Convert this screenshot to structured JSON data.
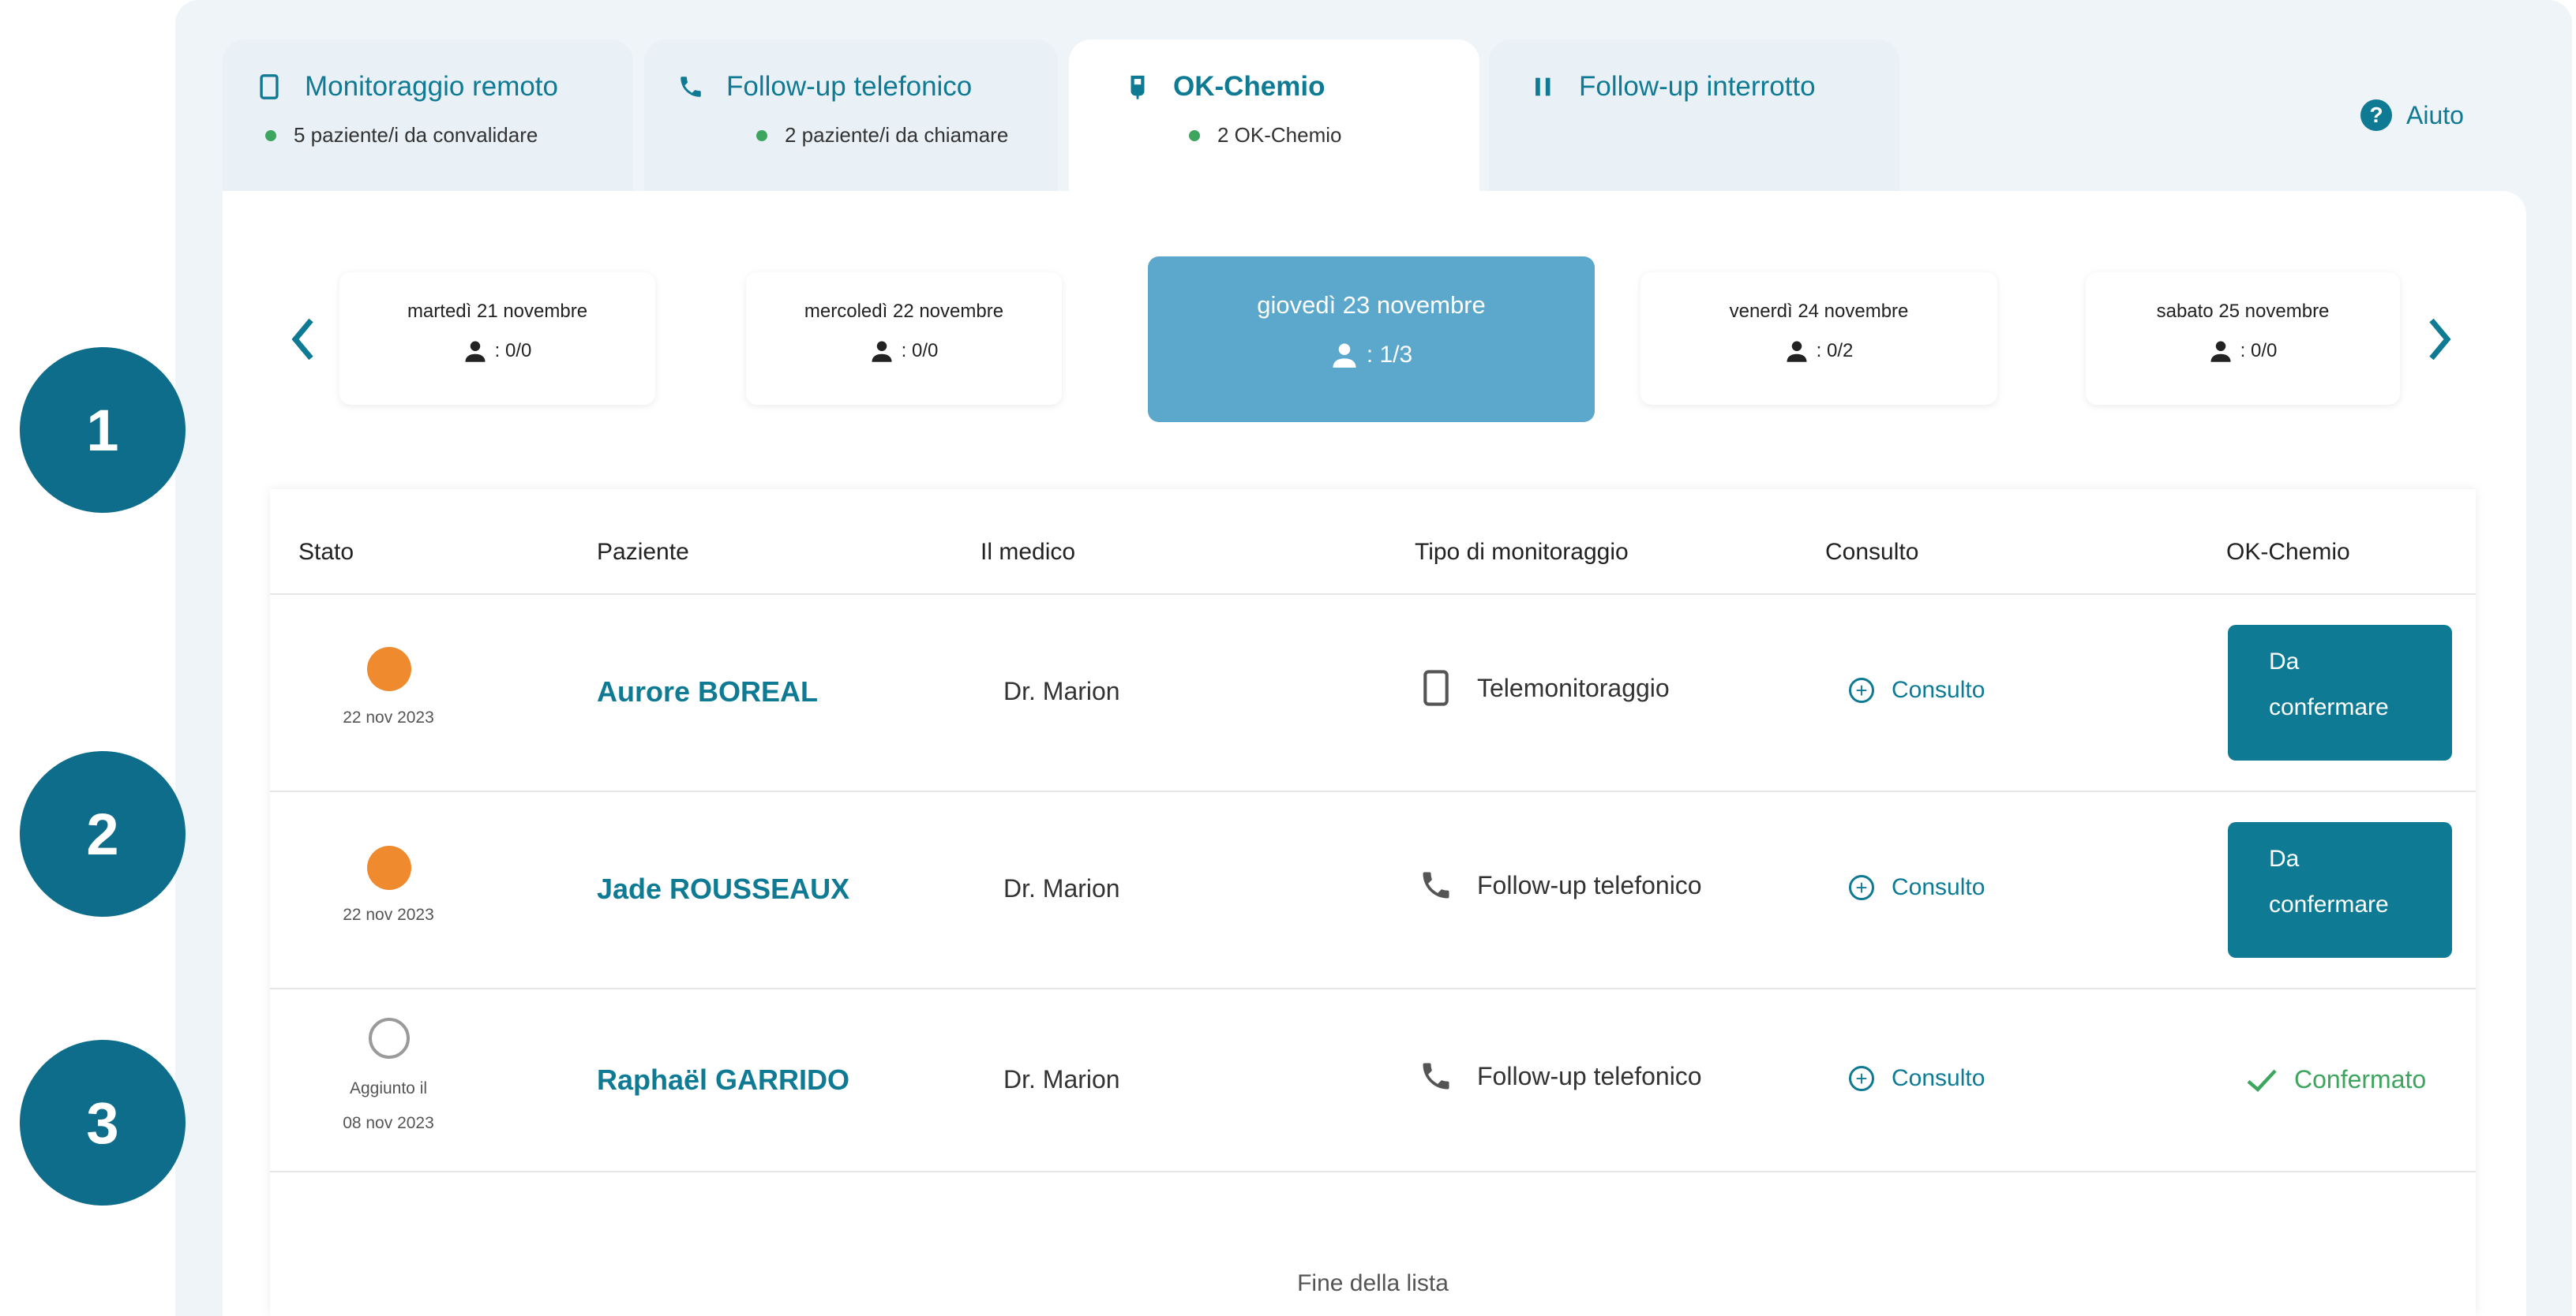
{
  "tabs": [
    {
      "title": "Monitoraggio remoto",
      "subtitle": "5 paziente/i da convalidare",
      "icon": "mobile-icon",
      "active": false
    },
    {
      "title": "Follow-up telefonico",
      "subtitle": "2 paziente/i da chiamare",
      "icon": "phone-icon",
      "active": false
    },
    {
      "title": "OK-Chemio",
      "subtitle": "2 OK-Chemio",
      "icon": "iv-bag-icon",
      "active": true
    },
    {
      "title": "Follow-up interrotto",
      "subtitle": "",
      "icon": "pause-icon",
      "active": false
    }
  ],
  "help": {
    "label": "Aiuto"
  },
  "days": [
    {
      "label": "martedì 21 novembre",
      "count": ": 0/0"
    },
    {
      "label": "mercoledì 22 novembre",
      "count": ": 0/0"
    },
    {
      "label": "giovedì 23 novembre",
      "count": ": 1/3",
      "active": true
    },
    {
      "label": "venerdì 24 novembre",
      "count": ": 0/2"
    },
    {
      "label": "sabato 25 novembre",
      "count": ": 0/0"
    }
  ],
  "table": {
    "headers": {
      "status": "Stato",
      "patient": "Paziente",
      "doctor": "Il medico",
      "monitoring": "Tipo di monitoraggio",
      "consult": "Consulto",
      "okchemio": "OK-Chemio"
    },
    "rows": [
      {
        "status": "orange",
        "date": "22 nov 2023",
        "patient": "Aurore BOREAL",
        "doctor": "Dr. Marion",
        "monitoring": "Telemonitoraggio",
        "consult": "Consulto",
        "action_line1": "Da",
        "action_line2": "confermare"
      },
      {
        "status": "orange",
        "date": "22 nov 2023",
        "patient": "Jade ROUSSEAUX",
        "doctor": "Dr. Marion",
        "monitoring": "Follow-up telefonico",
        "consult": "Consulto",
        "action_line1": "Da",
        "action_line2": "confermare"
      },
      {
        "status": "empty",
        "date_line1": "Aggiunto il",
        "date_line2": "08 nov 2023",
        "patient": "Raphaël GARRIDO",
        "doctor": "Dr. Marion",
        "monitoring": "Follow-up telefonico",
        "consult": "Consulto",
        "confirmed": "Confermato"
      }
    ],
    "end_label": "Fine della lista"
  },
  "badges": [
    "1",
    "2",
    "3"
  ],
  "colors": {
    "primary": "#0f7a94",
    "active_day": "#5ba8cc",
    "status_orange": "#f08a2e",
    "confirmed_green": "#3da55e",
    "badge": "#0e6d8a"
  }
}
